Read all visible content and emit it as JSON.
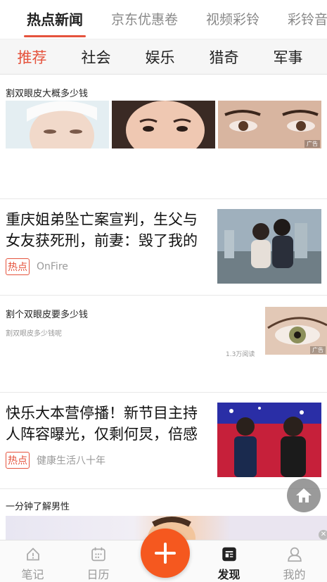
{
  "top_tabs": [
    {
      "label": "热点新闻"
    },
    {
      "label": "京东优惠卷"
    },
    {
      "label": "视频彩铃"
    },
    {
      "label": "彩铃音"
    }
  ],
  "categories": [
    {
      "label": "推荐"
    },
    {
      "label": "社会"
    },
    {
      "label": "娱乐"
    },
    {
      "label": "猎奇"
    },
    {
      "label": "军事"
    }
  ],
  "feed": {
    "ad1": {
      "title": "割双眼皮大概多少钱",
      "tag": "广告"
    },
    "news1": {
      "title": "重庆姐弟坠亡案宣判，生父与女友获死刑，前妻：毁了我的",
      "hot": "热点",
      "source": "OnFire"
    },
    "ad2": {
      "title": "割个双眼皮要多少钱",
      "subtitle": "割双眼皮多少钱呢",
      "reads": "1.3万阅读",
      "tag": "广告"
    },
    "news2": {
      "title": "快乐大本营停播！新节目主持人阵容曝光，仅剩何炅，倍感",
      "hot": "热点",
      "source": "健康生活八十年"
    },
    "ad3": {
      "title": "一分钟了解男性"
    }
  },
  "bottom_nav": [
    {
      "label": "笔记",
      "icon": "note-icon"
    },
    {
      "label": "日历",
      "icon": "calendar-icon"
    },
    {
      "label": "发现",
      "icon": "discover-icon"
    },
    {
      "label": "我的",
      "icon": "profile-icon"
    }
  ],
  "colors": {
    "accent": "#e5533d",
    "fab": "#f5581f"
  }
}
